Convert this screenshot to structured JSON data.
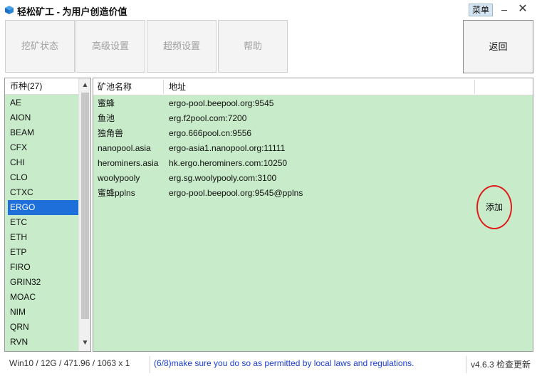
{
  "window": {
    "title": "轻松矿工 - 为用户创造价值",
    "menu_label": "菜单",
    "minimize_glyph": "–",
    "close_glyph": "✕"
  },
  "toolbar": {
    "tabs": [
      "挖矿状态",
      "高级设置",
      "超频设置",
      "帮助"
    ],
    "back_label": "返回"
  },
  "coins": {
    "header": "币种(27)",
    "items": [
      "AE",
      "AION",
      "BEAM",
      "CFX",
      "CHI",
      "CLO",
      "CTXC",
      "ERGO",
      "ETC",
      "ETH",
      "ETP",
      "FIRO",
      "GRIN32",
      "MOAC",
      "NIM",
      "QRN",
      "RVN"
    ],
    "selected": "ERGO",
    "scroll_up_glyph": "▲",
    "scroll_down_glyph": "▼"
  },
  "pools": {
    "columns": [
      "矿池名称",
      "地址"
    ],
    "rows": [
      {
        "name": "蜜蜂",
        "address": "ergo-pool.beepool.org:9545"
      },
      {
        "name": "鱼池",
        "address": "erg.f2pool.com:7200"
      },
      {
        "name": "独角兽",
        "address": "ergo.666pool.cn:9556"
      },
      {
        "name": "nanopool.asia",
        "address": "ergo-asia1.nanopool.org:11111"
      },
      {
        "name": "herominers.asia",
        "address": "hk.ergo.herominers.com:10250"
      },
      {
        "name": "woolypooly",
        "address": "erg.sg.woolypooly.com:3100"
      },
      {
        "name": "蜜蜂pplns",
        "address": "ergo-pool.beepool.org:9545@pplns"
      }
    ],
    "add_label": "添加"
  },
  "status": {
    "system_info": "Win10  / 12G / 471.96 / 1063 x 1",
    "notice": "(6/8)make sure you do so as permitted by local laws and regulations.",
    "version": "v4.6.3 检查更新"
  },
  "colors": {
    "panel_bg": "#c8ebc9",
    "selection": "#1e6fd9",
    "notice_text": "#1a3fd1",
    "add_circle": "#e11b1b"
  }
}
